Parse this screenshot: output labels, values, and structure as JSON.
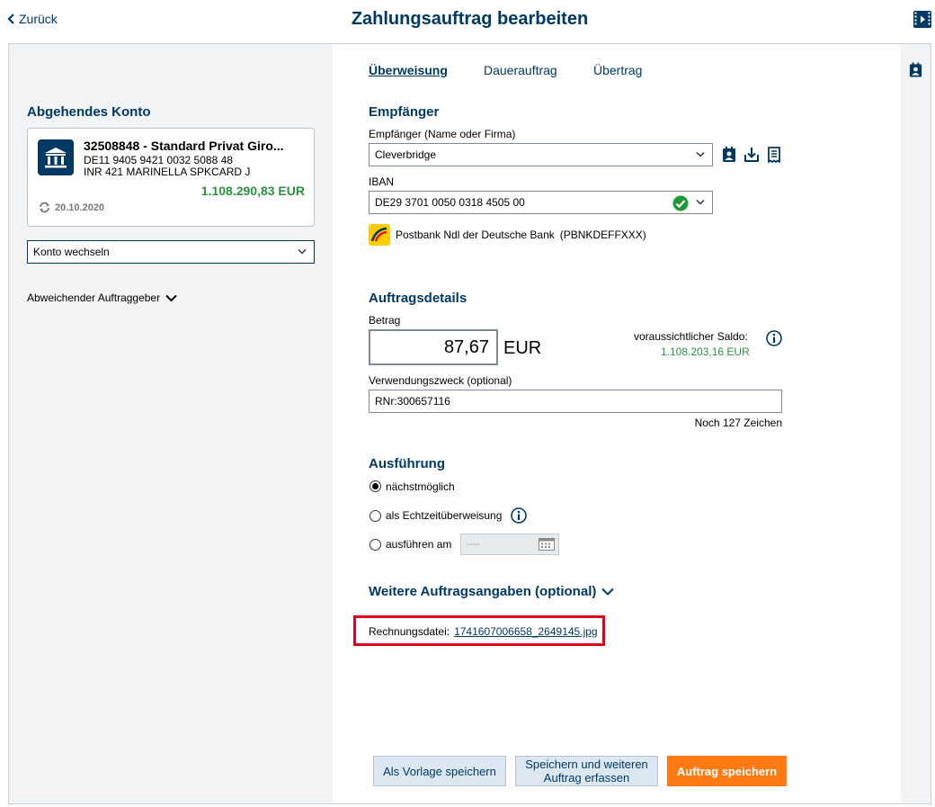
{
  "header": {
    "back_label": "Zurück",
    "title": "Zahlungsauftrag bearbeiten"
  },
  "sidebar": {
    "title": "Abgehendes Konto",
    "account": {
      "name": "32508848 - Standard Privat Giro...",
      "iban": "DE11 9405 9421 0032 5088 48",
      "card": "INR 421 MARINELLA SPKCARD J",
      "balance": "1.108.290,83 EUR",
      "date": "20.10.2020"
    },
    "switch_select": "Konto wechseln",
    "other_payer": "Abweichender Auftraggeber"
  },
  "tabs": [
    {
      "label": "Überweisung",
      "active": true
    },
    {
      "label": "Dauerauftrag",
      "active": false
    },
    {
      "label": "Übertrag",
      "active": false
    }
  ],
  "recipient": {
    "section_title": "Empfänger",
    "name_label": "Empfänger (Name oder Firma)",
    "name_value": "Cleverbridge",
    "iban_label": "IBAN",
    "iban_value": "DE29 3701 0050 0318 4505 00",
    "bank_name": "Postbank Ndl der Deutsche Bank",
    "bic": "(PBNKDEFFXXX)"
  },
  "details": {
    "section_title": "Auftragsdetails",
    "amount_label": "Betrag",
    "amount_value": "87,67",
    "currency": "EUR",
    "saldo_label": "voraussichtlicher Saldo:",
    "saldo_value": "1.108.203,16 EUR",
    "purpose_label": "Verwendungszweck (optional)",
    "purpose_value": "RNr:300657116",
    "chars_left": "Noch 127 Zeichen"
  },
  "execution": {
    "section_title": "Ausführung",
    "options": [
      {
        "label": "nächstmöglich",
        "selected": true
      },
      {
        "label": "als Echtzeitüberweisung",
        "selected": false
      },
      {
        "label": "ausführen am",
        "selected": false
      }
    ],
    "date_placeholder": "----"
  },
  "more": {
    "title": "Weitere Auftragsangaben (optional)",
    "invoice_label": "Rechnungsdatei:",
    "invoice_file": "1741607006658_2649145.jpg"
  },
  "buttons": {
    "save_template": "Als Vorlage speichern",
    "save_and_new": "Speichern und weiteren Auftrag erfassen",
    "save_order": "Auftrag speichern"
  },
  "colors": {
    "brand": "#003a64",
    "positive": "#2a9340",
    "primary_button": "#ff7a12",
    "highlight": "#e3001b",
    "check": "#1f9a3a"
  }
}
